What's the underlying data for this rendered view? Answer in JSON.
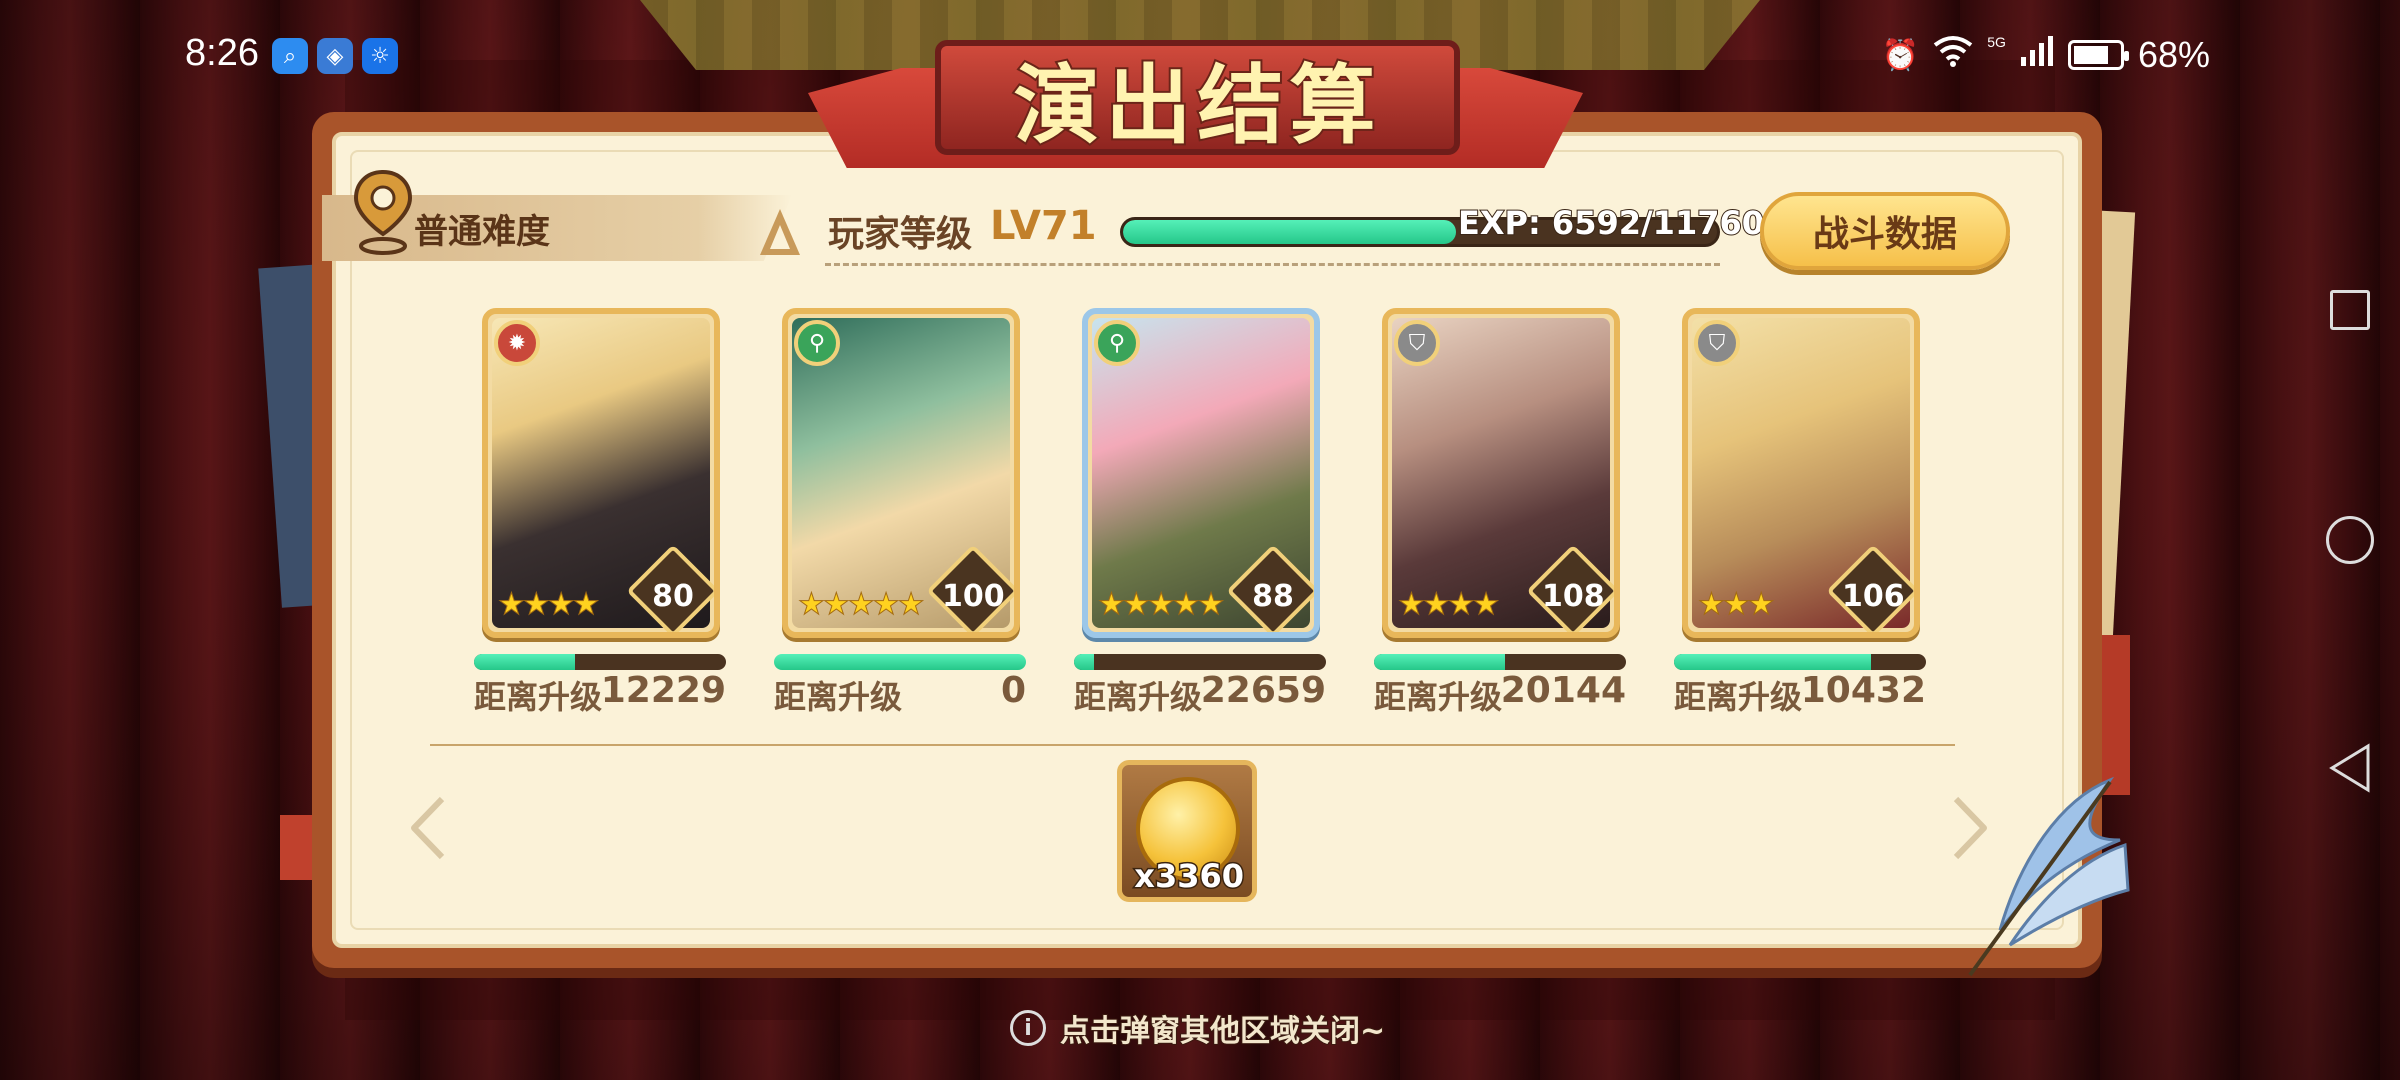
{
  "status_bar": {
    "time": "8:26",
    "notifications": [
      "search-app-icon",
      "browser-app-icon",
      "tips-app-icon"
    ],
    "network": "5G",
    "battery_percent": "68%",
    "battery_level": 0.68
  },
  "dialog": {
    "title": "演出结算",
    "difficulty": "普通难度",
    "player_level_label": "玩家等级",
    "player_level_value": "LV71",
    "exp_text": "EXP: 6592/11760",
    "exp_fraction": 0.56,
    "battle_data_button": "战斗数据",
    "upgrade_label": "距离升级",
    "cards": [
      {
        "element": "fire",
        "element_color": "#c9483a",
        "stars": "★★★★",
        "level": "80",
        "upgrade_remaining": "12229",
        "progress": 0.4,
        "frame": "gold"
      },
      {
        "element": "wind",
        "element_color": "#3aa45a",
        "stars": "★★★★★",
        "level": "100",
        "upgrade_remaining": "0",
        "progress": 1.0,
        "frame": "gold"
      },
      {
        "element": "wind",
        "element_color": "#3aa45a",
        "stars": "★★★★★",
        "level": "88",
        "upgrade_remaining": "22659",
        "progress": 0.08,
        "frame": "blue"
      },
      {
        "element": "shield",
        "element_color": "#8a8a8a",
        "stars": "★★★★",
        "level": "108",
        "upgrade_remaining": "20144",
        "progress": 0.52,
        "frame": "gold"
      },
      {
        "element": "shield",
        "element_color": "#8a8a8a",
        "stars": "★★★",
        "level": "106",
        "upgrade_remaining": "10432",
        "progress": 0.78,
        "frame": "gold"
      }
    ],
    "reward": {
      "icon": "gold-coin-icon",
      "quantity": "x3360"
    },
    "close_hint": "点击弹窗其他区域关闭~"
  },
  "colors": {
    "accent_green": "#25c789",
    "panel_border": "#a9542a",
    "panel_bg": "#fbf2d8",
    "title_text": "#fff3b0"
  }
}
